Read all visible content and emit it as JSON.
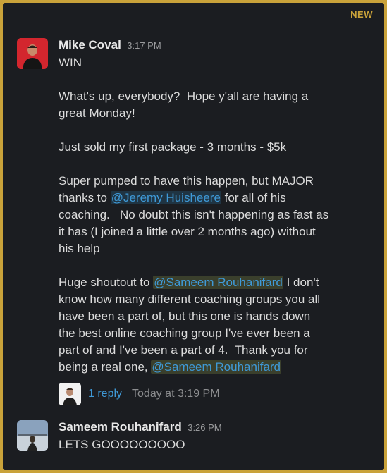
{
  "banner": {
    "new_label": "NEW"
  },
  "message1": {
    "author": "Mike Coval",
    "time": "3:17 PM",
    "lines": [
      "WIN",
      "",
      "What's up, everybody?  Hope y'all are having a",
      "great Monday!",
      "",
      "Just sold my first package - 3 months - $5k",
      "",
      "Super pumped to have this happen, but MAJOR"
    ],
    "mention_line_prefix": "thanks to ",
    "mention1": "@Jeremy Huisheere",
    "mention_line_suffix": " for all of his",
    "lines2": [
      "coaching.   No doubt this isn't happening as fast as",
      "it has (I joined a little over 2 months ago) without",
      "his help",
      ""
    ],
    "shout_prefix": "Huge shoutout to ",
    "mention2": "@Sameem Rouhanifard",
    "shout_suffix": " I don't",
    "lines3": [
      "know how many different coaching groups you all",
      "have been a part of, but this one is hands down",
      "the best online coaching group I've ever been a",
      "part of and I've been a part of 4.  Thank you for"
    ],
    "last_prefix": "being a real one, ",
    "mention3": "@Sameem Rouhanifard"
  },
  "thread": {
    "reply_label": "1 reply",
    "reply_time": "Today at 3:19 PM"
  },
  "message2": {
    "author": "Sameem Rouhanifard",
    "time": "3:26 PM",
    "text": "LETS GOOOOOOOOO"
  }
}
